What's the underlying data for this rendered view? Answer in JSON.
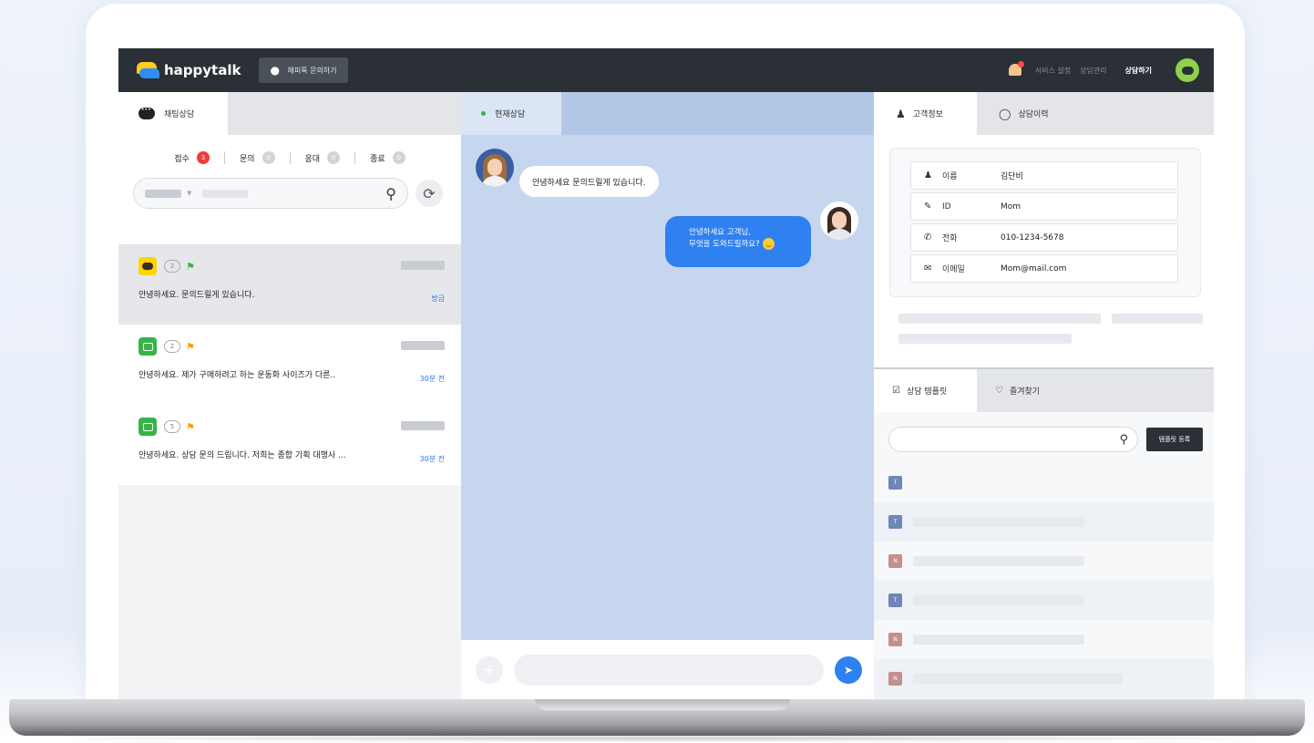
{
  "topbar": {
    "logo": "happytalk",
    "help_button": "해피톡 문의하기",
    "links": [
      "서비스 설정",
      "상담관리",
      "상담하기"
    ]
  },
  "left": {
    "tab": "채팅상담",
    "statuses": [
      {
        "label": "접수",
        "count": "3"
      },
      {
        "label": "문의",
        "count": "0"
      },
      {
        "label": "응대",
        "count": "0"
      },
      {
        "label": "종료",
        "count": "0"
      }
    ],
    "conversations": [
      {
        "channel": "kakao",
        "count": "2",
        "flag": "green",
        "text": "안녕하세요. 문의드릴게 있습니다.",
        "time": "방금"
      },
      {
        "channel": "talk",
        "count": "2",
        "flag": "orange",
        "text": "안녕하세요. 제가 구매하려고 하는 운동화 사이즈가 다른..",
        "time": "30분 전"
      },
      {
        "channel": "talk",
        "count": "5",
        "flag": "orange",
        "text": "안녕하세요. 상담 문의 드립니다. 저희는 종합 기획 대행사 ...",
        "time": "30분 전"
      }
    ]
  },
  "middle": {
    "tab": "현재상담",
    "messages": {
      "customer": "안녕하세요 문의드릴게 있습니다.",
      "agent_line1": "안녕하세요 고객님,",
      "agent_line2": "무엇을 도와드릴까요?"
    }
  },
  "right": {
    "tabs": [
      "고객정보",
      "상담이력"
    ],
    "customer_info": [
      {
        "icon": "person-icon",
        "key": "이름",
        "value": "김단비"
      },
      {
        "icon": "pen-icon",
        "key": "ID",
        "value": "Mom"
      },
      {
        "icon": "phone-icon",
        "key": "전화",
        "value": "010-1234-5678"
      },
      {
        "icon": "mail-icon",
        "key": "이메일",
        "value": "Mom@mail.com"
      }
    ],
    "template_tabs": [
      "상담 템플릿",
      "즐겨찾기"
    ],
    "template_register": "템플릿 등록",
    "template_badges": [
      "T",
      "T",
      "N",
      "T",
      "N",
      "N"
    ]
  },
  "colors": {
    "topbar": "#2b2f36",
    "accent_blue": "#2f80f0",
    "badge_red": "#f23a3a",
    "kakao_yellow": "#ffd400",
    "talk_green": "#35b549",
    "chat_background": "#c6d6ee"
  }
}
